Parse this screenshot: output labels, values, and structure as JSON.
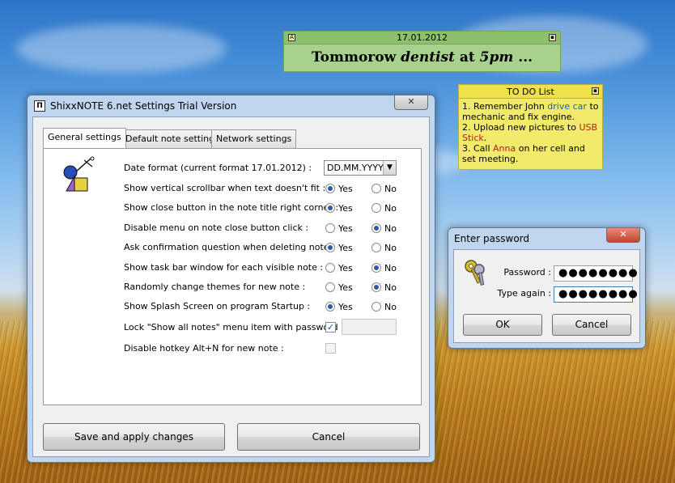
{
  "note_green": {
    "date": "17.01.2012",
    "text_part1": "Tommorow ",
    "text_part2": "dentist",
    "text_part3": " at ",
    "text_part4": "5pm",
    "text_part5": " ..."
  },
  "note_yellow": {
    "title": "TO DO List",
    "line1_a": "1. Remember John ",
    "line1_b": "drive car",
    "line1_c": " to mechanic and fix engine.",
    "line2_a": "2. Upload new pictures to ",
    "line2_b": "USB Stick",
    "line2_c": ".",
    "line3_a": "3. Call ",
    "line3_b": "Anna",
    "line3_c": " on her cell and set meeting."
  },
  "settings": {
    "title": "ShixxNOTE 6.net Settings Trial Version",
    "close_label": "✕",
    "tabs": [
      "General settings",
      "Default note settings",
      "Network settings"
    ],
    "date_format_label": "Date format (current format 17.01.2012) :",
    "date_format_value": "DD.MM.YYYY",
    "yes": "Yes",
    "no": "No",
    "options": [
      {
        "label": "Show vertical scrollbar when text doesn't fit :",
        "selected": "yes"
      },
      {
        "label": "Show close button in the note title right corner :",
        "selected": "yes"
      },
      {
        "label": "Disable menu on note close button click :",
        "selected": "no"
      },
      {
        "label": "Ask confirmation question when deleting note :",
        "selected": "yes"
      },
      {
        "label": "Show task bar window for each visible note :",
        "selected": "no"
      },
      {
        "label": "Randomly change themes for new note :",
        "selected": "no"
      },
      {
        "label": "Show Splash Screen on program Startup :",
        "selected": "yes"
      }
    ],
    "lock_label": "Lock \"Show all notes\" menu item with password :",
    "lock_checked": true,
    "hotkey_label": "Disable hotkey Alt+N for new note :",
    "hotkey_checked": false,
    "save_label": "Save and apply changes",
    "cancel_label": "Cancel"
  },
  "password_dialog": {
    "title": "Enter password",
    "close_label": "✕",
    "password_label": "Password :",
    "password_value": "●●●●●●●●",
    "again_label": "Type again :",
    "again_value": "●●●●●●●●",
    "ok_label": "OK",
    "cancel_label": "Cancel"
  }
}
